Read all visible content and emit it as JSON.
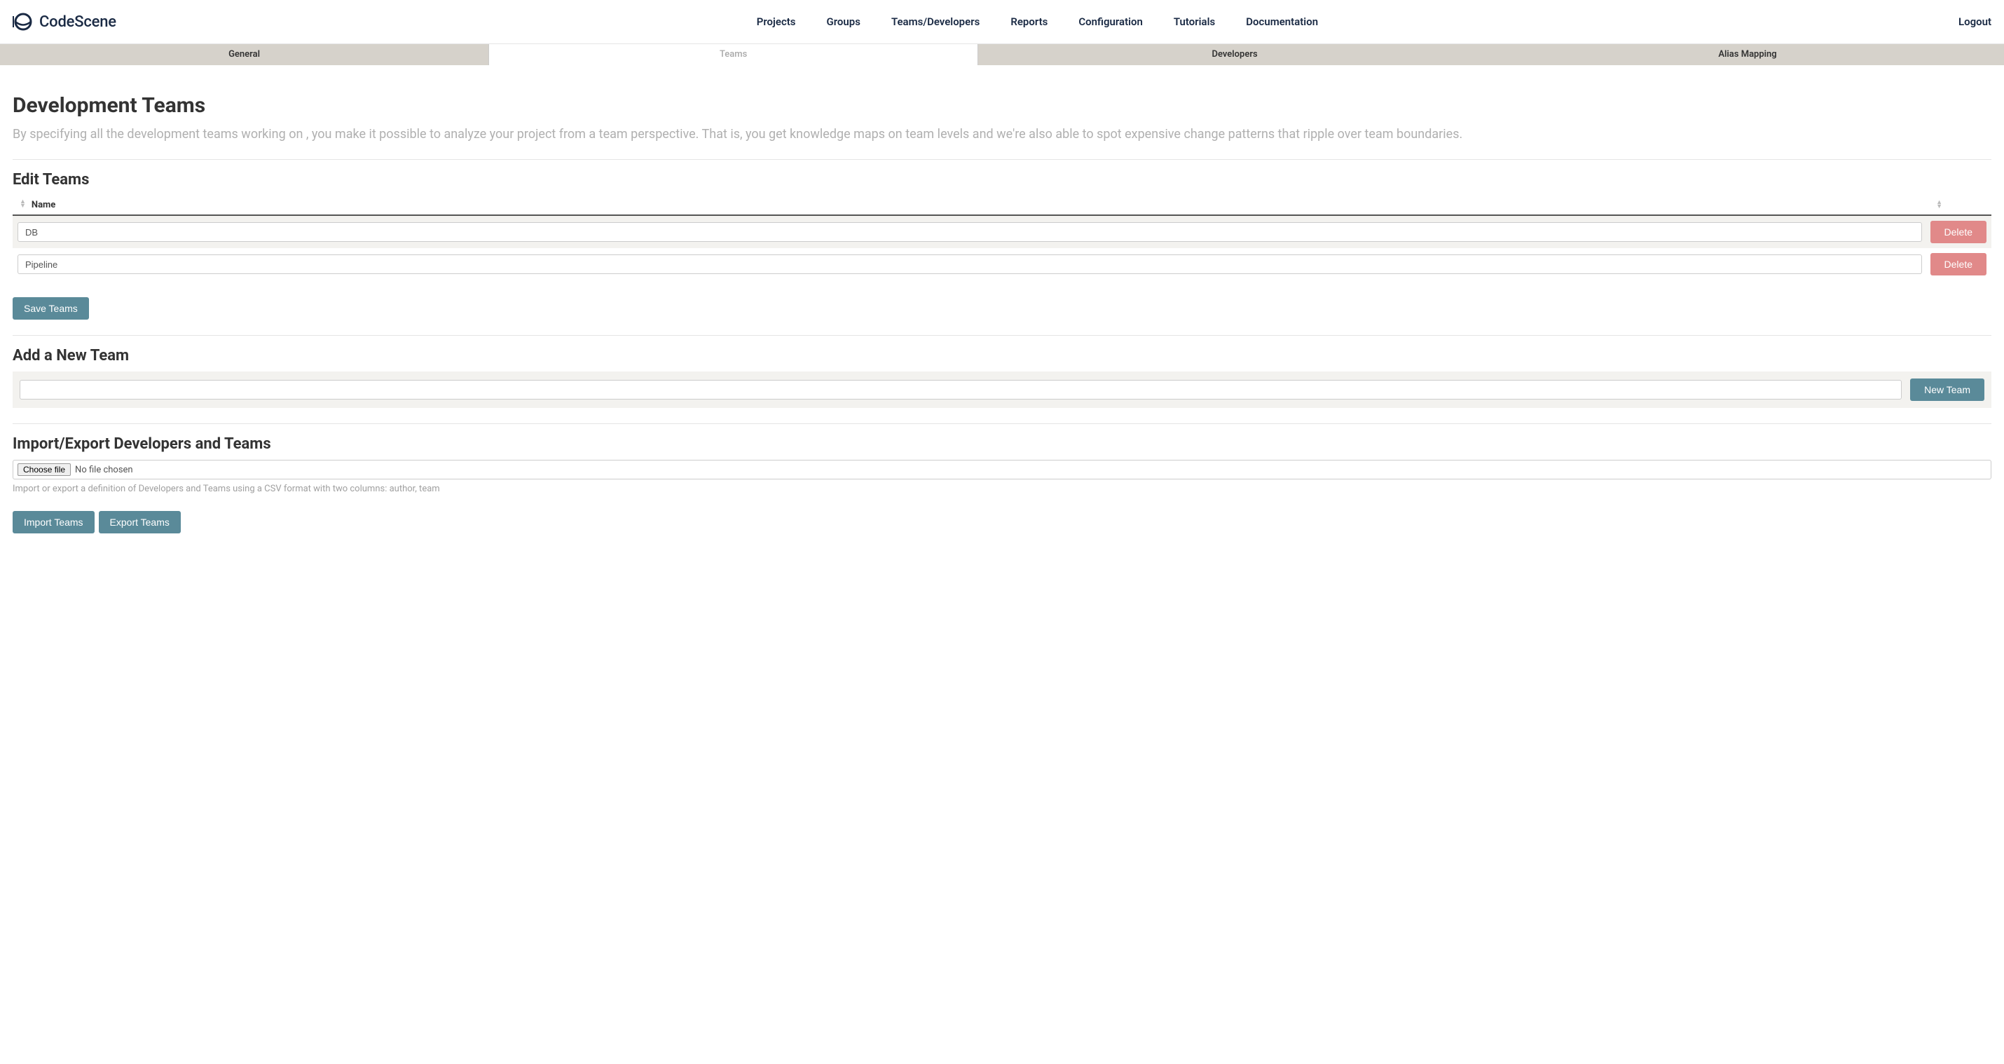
{
  "brand": {
    "name": "CodeScene"
  },
  "nav": {
    "items": [
      "Projects",
      "Groups",
      "Teams/Developers",
      "Reports",
      "Configuration",
      "Tutorials",
      "Documentation"
    ],
    "logout": "Logout"
  },
  "subtabs": {
    "items": [
      "General",
      "Teams",
      "Developers",
      "Alias Mapping"
    ],
    "active_index": 1
  },
  "header": {
    "title": "Development Teams",
    "description": "By specifying all the development teams working on , you make it possible to analyze your project from a team perspective. That is, you get knowledge maps on team levels and we're also able to spot expensive change patterns that ripple over team boundaries."
  },
  "edit": {
    "title": "Edit Teams",
    "col_name": "Name",
    "rows": [
      {
        "value": "DB"
      },
      {
        "value": "Pipeline"
      }
    ],
    "delete_label": "Delete",
    "save_label": "Save Teams"
  },
  "add": {
    "title": "Add a New Team",
    "value": "",
    "button": "New Team"
  },
  "io": {
    "title": "Import/Export Developers and Teams",
    "choose_file": "Choose file",
    "no_file": "No file chosen",
    "help": "Import or export a definition of Developers and Teams using a CSV format with two columns: author, team",
    "import": "Import Teams",
    "export": "Export Teams"
  }
}
